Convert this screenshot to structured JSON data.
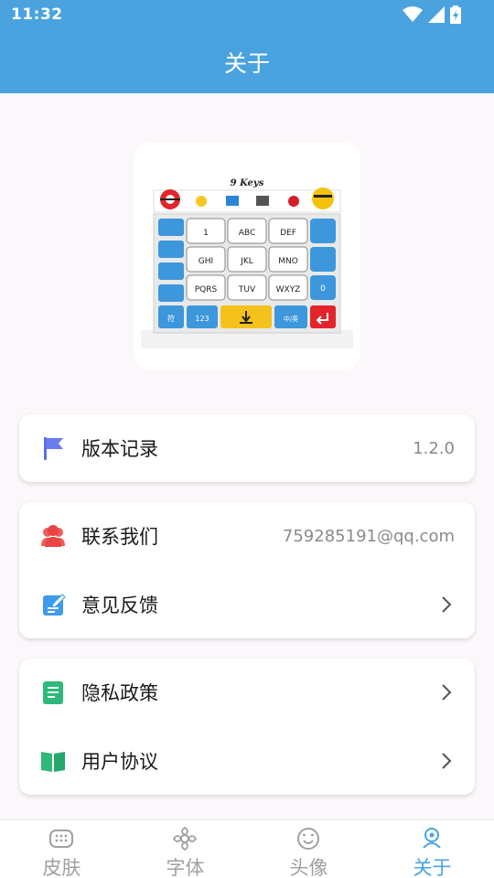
{
  "status_bar": {
    "time": "11:32"
  },
  "header": {
    "title": "关于"
  },
  "logo": {
    "caption": "9 Keys",
    "keys": [
      "1",
      "ABC",
      "DEF",
      "GHI",
      "JKL",
      "MNO",
      "PQRS",
      "TUV",
      "WXYZ"
    ],
    "left_keys": [
      "符",
      "123"
    ],
    "mid_key": "中/英",
    "side_key": "0"
  },
  "version_card": {
    "label": "版本记录",
    "value": "1.2.0"
  },
  "contact_card": {
    "contact_label": "联系我们",
    "contact_value": "759285191@qq.com",
    "feedback_label": "意见反馈"
  },
  "policy_card": {
    "privacy_label": "隐私政策",
    "agreement_label": "用户协议"
  },
  "bottom_nav": {
    "items": [
      {
        "label": "皮肤",
        "icon": "keyboard-icon"
      },
      {
        "label": "字体",
        "icon": "flower-icon"
      },
      {
        "label": "头像",
        "icon": "face-icon"
      },
      {
        "label": "关于",
        "icon": "about-icon"
      }
    ],
    "active_index": 3
  },
  "colors": {
    "accent": "#4aa3df",
    "background": "#fbf7fb"
  }
}
